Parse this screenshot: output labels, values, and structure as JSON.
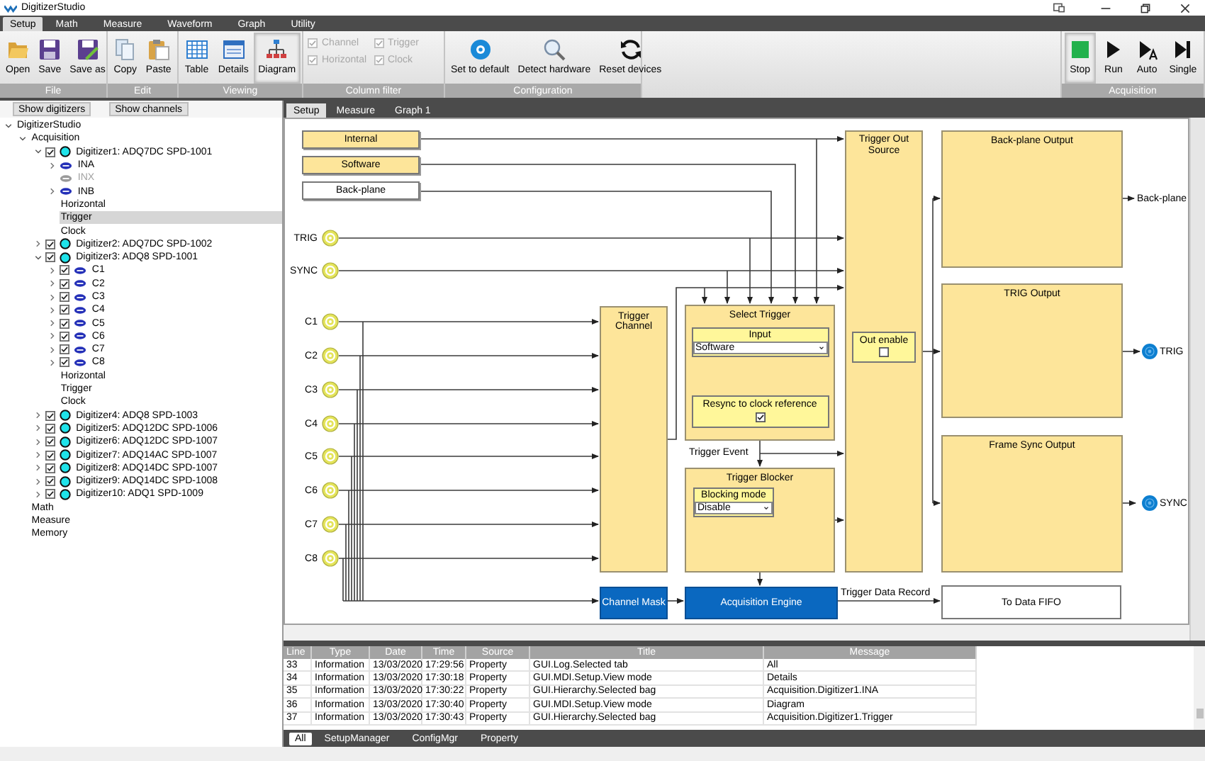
{
  "window": {
    "title": "DigitizerStudio"
  },
  "menu_tabs": [
    {
      "label": "Setup",
      "selected": true
    },
    {
      "label": "Math",
      "selected": false
    },
    {
      "label": "Measure",
      "selected": false
    },
    {
      "label": "Waveform",
      "selected": false
    },
    {
      "label": "Graph",
      "selected": false
    },
    {
      "label": "Utility",
      "selected": false
    }
  ],
  "ribbon": {
    "groups": [
      {
        "label": "File",
        "kind": "buttons",
        "items": [
          {
            "label": "Open"
          },
          {
            "label": "Save"
          },
          {
            "label": "Save as"
          }
        ]
      },
      {
        "label": "Edit",
        "kind": "buttons",
        "items": [
          {
            "label": "Copy"
          },
          {
            "label": "Paste"
          }
        ]
      },
      {
        "label": "Viewing",
        "kind": "buttons",
        "items": [
          {
            "label": "Table",
            "selected": false
          },
          {
            "label": "Details",
            "selected": false
          },
          {
            "label": "Diagram",
            "selected": true
          }
        ]
      },
      {
        "label": "Column filter",
        "kind": "checkboxes",
        "items": [
          {
            "label": "Channel",
            "checked": true,
            "disabled": true
          },
          {
            "label": "Trigger",
            "checked": true,
            "disabled": true
          },
          {
            "label": "Horizontal",
            "checked": true,
            "disabled": true
          },
          {
            "label": "Clock",
            "checked": true,
            "disabled": true
          }
        ]
      },
      {
        "label": "Configuration",
        "kind": "buttons",
        "items": [
          {
            "label": "Set to default"
          },
          {
            "label": "Detect hardware"
          },
          {
            "label": "Reset devices"
          }
        ]
      },
      {
        "label": "Acquisition",
        "kind": "buttons",
        "items": [
          {
            "label": "Stop",
            "selected": true
          },
          {
            "label": "Run",
            "selected": false
          },
          {
            "label": "Auto",
            "selected": false
          },
          {
            "label": "Single",
            "selected": false
          }
        ]
      }
    ]
  },
  "panel_buttons": [
    "Show digitizers",
    "Show channels"
  ],
  "tree": [
    {
      "label": "DigitizerStudio",
      "selected": false,
      "expanded": true,
      "children": [
        {
          "label": "Acquisition",
          "selected": false,
          "expanded": true,
          "children": [
            {
              "label": "Digitizer1: ADQ7DC SPD-1001",
              "kind": "digitizer",
              "selected": false,
              "expanded": true,
              "checked": true,
              "children": [
                {
                  "label": "INA",
                  "kind": "channel",
                  "selected": false,
                  "expanded": false,
                  "disabled": false
                },
                {
                  "label": "INX",
                  "kind": "channel",
                  "selected": false,
                  "disabled": true
                },
                {
                  "label": "INB",
                  "kind": "channel",
                  "selected": false,
                  "expanded": false,
                  "disabled": false
                },
                {
                  "label": "Horizontal",
                  "selected": false
                },
                {
                  "label": "Trigger",
                  "selected": true
                },
                {
                  "label": "Clock",
                  "selected": false
                }
              ]
            },
            {
              "label": "Digitizer2: ADQ7DC SPD-1002",
              "kind": "digitizer",
              "selected": false,
              "expanded": false,
              "checked": true
            },
            {
              "label": "Digitizer3: ADQ8 SPD-1001",
              "kind": "digitizer",
              "selected": false,
              "expanded": true,
              "checked": true,
              "children": [
                {
                  "label": "C1",
                  "kind": "channel",
                  "selected": false,
                  "expanded": false,
                  "checked": true
                },
                {
                  "label": "C2",
                  "kind": "channel",
                  "selected": false,
                  "expanded": false,
                  "checked": true
                },
                {
                  "label": "C3",
                  "kind": "channel",
                  "selected": false,
                  "expanded": false,
                  "checked": true
                },
                {
                  "label": "C4",
                  "kind": "channel",
                  "selected": false,
                  "expanded": false,
                  "checked": true
                },
                {
                  "label": "C5",
                  "kind": "channel",
                  "selected": false,
                  "expanded": false,
                  "checked": true
                },
                {
                  "label": "C6",
                  "kind": "channel",
                  "selected": false,
                  "expanded": false,
                  "checked": true
                },
                {
                  "label": "C7",
                  "kind": "channel",
                  "selected": false,
                  "expanded": false,
                  "checked": true
                },
                {
                  "label": "C8",
                  "kind": "channel",
                  "selected": false,
                  "expanded": false,
                  "checked": true
                },
                {
                  "label": "Horizontal",
                  "selected": false
                },
                {
                  "label": "Trigger",
                  "selected": false
                },
                {
                  "label": "Clock",
                  "selected": false
                }
              ]
            },
            {
              "label": "Digitizer4: ADQ8 SPD-1003",
              "kind": "digitizer",
              "selected": false,
              "expanded": false,
              "checked": true
            },
            {
              "label": "Digitizer5: ADQ12DC SPD-1006",
              "kind": "digitizer",
              "selected": false,
              "expanded": false,
              "checked": true
            },
            {
              "label": "Digitizer6: ADQ12DC SPD-1007",
              "kind": "digitizer",
              "selected": false,
              "expanded": false,
              "checked": true
            },
            {
              "label": "Digitizer7: ADQ14AC SPD-1007",
              "kind": "digitizer",
              "selected": false,
              "expanded": false,
              "checked": true
            },
            {
              "label": "Digitizer8: ADQ14DC SPD-1007",
              "kind": "digitizer",
              "selected": false,
              "expanded": false,
              "checked": true
            },
            {
              "label": "Digitizer9: ADQ14DC SPD-1008",
              "kind": "digitizer",
              "selected": false,
              "expanded": false,
              "checked": true
            },
            {
              "label": "Digitizer10: ADQ1 SPD-1009",
              "kind": "digitizer",
              "selected": false,
              "expanded": false,
              "checked": true
            }
          ]
        },
        {
          "label": "Math",
          "selected": false
        },
        {
          "label": "Measure",
          "selected": false
        },
        {
          "label": "Memory",
          "selected": false
        }
      ]
    }
  ],
  "document_tabs": [
    {
      "label": "Setup",
      "selected": true
    },
    {
      "label": "Measure",
      "selected": false
    },
    {
      "label": "Graph 1",
      "selected": false
    }
  ],
  "diagram": {
    "sources": [
      {
        "label": "Internal",
        "active": true
      },
      {
        "label": "Software",
        "active": true
      },
      {
        "label": "Back-plane",
        "active": false
      }
    ],
    "inputs": [
      {
        "label": "TRIG"
      },
      {
        "label": "SYNC"
      }
    ],
    "channels": [
      {
        "label": "C1"
      },
      {
        "label": "C2"
      },
      {
        "label": "C3"
      },
      {
        "label": "C4"
      },
      {
        "label": "C5"
      },
      {
        "label": "C6"
      },
      {
        "label": "C7"
      },
      {
        "label": "C8"
      }
    ],
    "trigger_channel": {
      "title": "Trigger Channel"
    },
    "select_trigger": {
      "title": "Select Trigger",
      "input": {
        "label": "Input",
        "value": "Software"
      },
      "resync": {
        "label": "Resync to clock reference",
        "checked": true
      }
    },
    "trigger_event": "Trigger Event",
    "trigger_blocker": {
      "title": "Trigger Blocker",
      "blocking_mode": {
        "label": "Blocking mode",
        "value": "Disable"
      }
    },
    "trigger_out_source": {
      "title": "Trigger Out Source",
      "out_enable": {
        "label": "Out enable",
        "checked": false
      }
    },
    "outputs": [
      {
        "title": "Back-plane Output",
        "target": "Back-plane",
        "kind": "plain"
      },
      {
        "title": "TRIG Output",
        "target": "TRIG",
        "kind": "connector"
      },
      {
        "title": "Frame Sync Output",
        "target": "SYNC",
        "kind": "connector"
      }
    ],
    "channel_mask": "Channel Mask",
    "acquisition_engine": "Acquisition Engine",
    "trigger_data_record": "Trigger Data Record",
    "to_data_fifo": "To Data FIFO"
  },
  "log": {
    "columns": [
      "Line",
      "Type",
      "Date",
      "Time",
      "Source",
      "Title",
      "Message"
    ],
    "rows": [
      [
        "33",
        "Information",
        "13/03/2020",
        "17:29:56",
        "Property",
        "GUI.Log.Selected tab",
        "All"
      ],
      [
        "34",
        "Information",
        "13/03/2020",
        "17:30:18",
        "Property",
        "GUI.MDI.Setup.View mode",
        "Details"
      ],
      [
        "35",
        "Information",
        "13/03/2020",
        "17:30:22",
        "Property",
        "GUI.Hierarchy.Selected bag",
        "Acquisition.Digitizer1.INA"
      ],
      [
        "36",
        "Information",
        "13/03/2020",
        "17:30:40",
        "Property",
        "GUI.MDI.Setup.View mode",
        "Diagram"
      ],
      [
        "37",
        "Information",
        "13/03/2020",
        "17:30:43",
        "Property",
        "GUI.Hierarchy.Selected bag",
        "Acquisition.Digitizer1.Trigger"
      ]
    ],
    "tabs": [
      {
        "label": "All",
        "selected": true
      },
      {
        "label": "SetupManager",
        "selected": false
      },
      {
        "label": "ConfigMgr",
        "selected": false
      },
      {
        "label": "Property",
        "selected": false
      }
    ]
  }
}
